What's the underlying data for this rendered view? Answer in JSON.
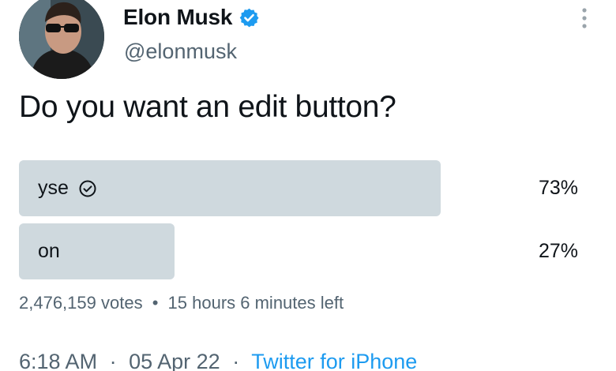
{
  "author": {
    "display_name": "Elon Musk",
    "handle": "@elonmusk",
    "verified": true,
    "avatar_icon": "profile-photo"
  },
  "tweet": {
    "text": "Do you want an edit button?"
  },
  "poll": {
    "options": [
      {
        "label": "yse",
        "percent_text": "73%",
        "percent": 73,
        "selected": true
      },
      {
        "label": "on",
        "percent_text": "27%",
        "percent": 27,
        "selected": false
      }
    ],
    "votes_text": "2,476,159 votes",
    "separator": "•",
    "time_left": "15 hours 6 minutes left"
  },
  "meta": {
    "time": "6:18 AM",
    "date": "05 Apr 22",
    "separator": "·",
    "source": "Twitter for iPhone"
  },
  "colors": {
    "bar": "#cfd9de",
    "link": "#1d9bf0",
    "verified": "#1d9bf0",
    "secondary_text": "#536471"
  },
  "icons": {
    "verified": "verified-badge-icon",
    "more": "more-vertical-icon",
    "selected": "check-circle-icon"
  }
}
